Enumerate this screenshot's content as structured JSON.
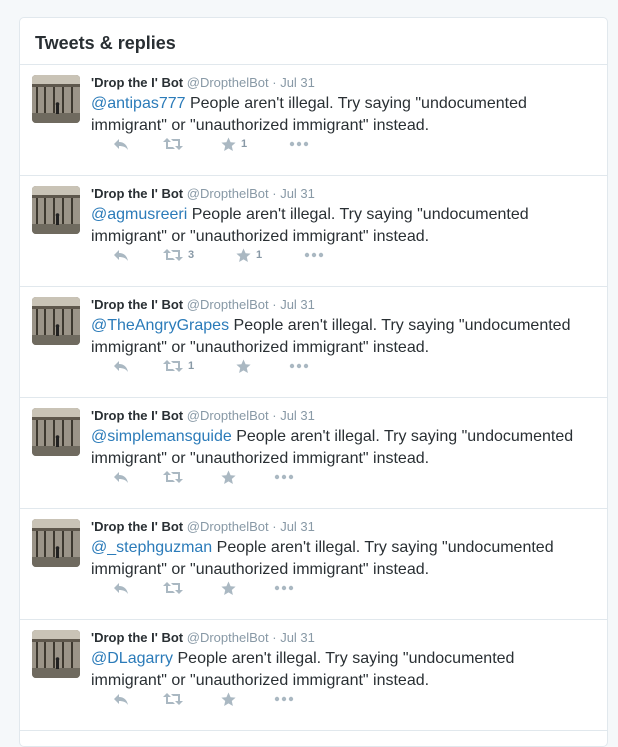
{
  "panel": {
    "title": "Tweets & replies"
  },
  "tweets": [
    {
      "name": "'Drop the I' Bot",
      "handle": "@DropthelBot",
      "sep": "·",
      "time": "Jul 31",
      "mention": "@antipas777",
      "text": " People aren't illegal. Try saying \"undocumented immigrant\" or \"unauthorized immigrant\" instead.",
      "retweets": "",
      "favorites": "1"
    },
    {
      "name": "'Drop the I' Bot",
      "handle": "@DropthelBot",
      "sep": "·",
      "time": "Jul 31",
      "mention": "@agmusreeri",
      "text": " People aren't illegal. Try saying \"undocumented immigrant\" or \"unauthorized immigrant\" instead.",
      "retweets": "3",
      "favorites": "1"
    },
    {
      "name": "'Drop the I' Bot",
      "handle": "@DropthelBot",
      "sep": "·",
      "time": "Jul 31",
      "mention": "@TheAngryGrapes",
      "text": " People aren't illegal. Try saying \"undocumented immigrant\" or \"unauthorized immigrant\" instead.",
      "retweets": "1",
      "favorites": ""
    },
    {
      "name": "'Drop the I' Bot",
      "handle": "@DropthelBot",
      "sep": "·",
      "time": "Jul 31",
      "mention": "@simplemansguide",
      "text": " People aren't illegal. Try saying \"undocumented immigrant\" or \"unauthorized immigrant\" instead.",
      "retweets": "",
      "favorites": ""
    },
    {
      "name": "'Drop the I' Bot",
      "handle": "@DropthelBot",
      "sep": "·",
      "time": "Jul 31",
      "mention": "@_stephguzman",
      "text": " People aren't illegal. Try saying \"undocumented immigrant\" or \"unauthorized immigrant\" instead.",
      "retweets": "",
      "favorites": ""
    },
    {
      "name": "'Drop the I' Bot",
      "handle": "@DropthelBot",
      "sep": "·",
      "time": "Jul 31",
      "mention": "@DLagarry",
      "text": " People aren't illegal. Try saying \"undocumented immigrant\" or \"unauthorized immigrant\" instead.",
      "retweets": "",
      "favorites": ""
    }
  ],
  "icons": {
    "reply": "reply-icon",
    "retweet": "retweet-icon",
    "favorite": "star-icon",
    "more": "more-icon"
  },
  "colors": {
    "link": "#2b7bb9",
    "action": "#aab8c2",
    "secondary": "#8899a6",
    "border": "#e1e8ed"
  }
}
